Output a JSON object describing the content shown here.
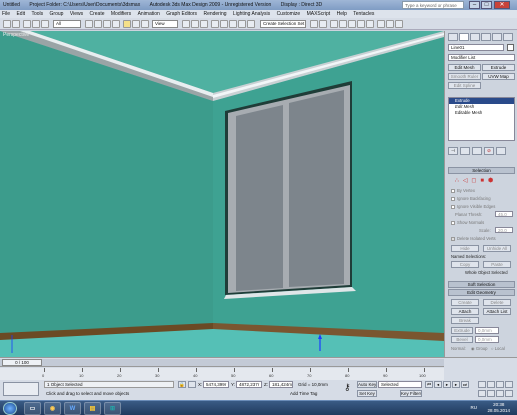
{
  "titlebar": {
    "left_title": "Untitled",
    "project_folder": "Project Folder: C:\\Users\\User\\Documents\\3dsmax",
    "app_title": "Autodesk 3ds Max Design 2009 - Unregistered Version",
    "display": "Display : Direct 3D",
    "search_placeholder": "Type a keyword or phrase"
  },
  "menu": [
    "File",
    "Edit",
    "Tools",
    "Group",
    "Views",
    "Create",
    "Modifiers",
    "Animation",
    "Graph Editors",
    "Rendering",
    "Lighting Analysis",
    "Customize",
    "MAXScript",
    "Help",
    "Tentacles"
  ],
  "toolbar": {
    "filter": "All",
    "view": "View",
    "selection_set": "Create Selection Set"
  },
  "viewport": {
    "label": "Perspective"
  },
  "panel": {
    "object_name": "Line01",
    "modifier_list": "Modifier List",
    "buttons": [
      "Edit Mesh",
      "Extrude",
      "Smooth Ruler",
      "UVW Map",
      "Edit Spline"
    ],
    "stack": [
      "Extrude",
      "Edit Mesh",
      "Editable Mesh"
    ],
    "rollouts": {
      "selection": "Selection",
      "by_vertex": "By Vertex",
      "ignore_backfacing": "Ignore Backfacing",
      "ignore_visible_edges": "Ignore Visible Edges",
      "planar_thresh": "Planar Thresh:",
      "planar_value": "45,0",
      "show_normals": "Show Normals",
      "scale": "Scale:",
      "scale_value": "20,0",
      "delete_isolated": "Delete Isolated Verts",
      "hide": "Hide",
      "unhide_all": "Unhide All",
      "named_selections": "Named Selections:",
      "copy": "Copy",
      "paste": "Paste",
      "whole_object": "Whole Object Selected",
      "soft_selection": "Soft Selection",
      "edit_geometry": "Edit Geometry",
      "create": "Create",
      "delete": "Delete",
      "attach": "Attach",
      "attach_list": "Attach List",
      "break": "Break",
      "extrude": "Extrude",
      "extrude_value": "0,0mm",
      "bevel": "Bevel",
      "bevel_value": "0,0mm",
      "normal": "Normal:",
      "group": "Group",
      "local": "Local",
      "slice_plane": "Slice Plane",
      "slice": "Slice",
      "cut": "Cut",
      "split": "Split"
    }
  },
  "timeline": {
    "frame": "0 / 100",
    "ticks": [
      "0",
      "10",
      "20",
      "30",
      "40",
      "50",
      "60",
      "70",
      "80",
      "90",
      "100"
    ]
  },
  "status": {
    "objects_selected": "1 Object Selected",
    "prompt": "Click and drag to select and move objects",
    "x_value": "5474,399r",
    "y_value": "4872,237r",
    "z_value": "181,424mn",
    "grid": "Grid = 10,0mm",
    "add_time_tag": "Add Time Tag",
    "auto_key": "Auto Key",
    "set_key": "Set Key",
    "key_mode": "Selected",
    "key_filters": "Key Filters..."
  },
  "taskbar": {
    "lang": "RU",
    "time": "20:38",
    "date": "28.05.2014"
  }
}
